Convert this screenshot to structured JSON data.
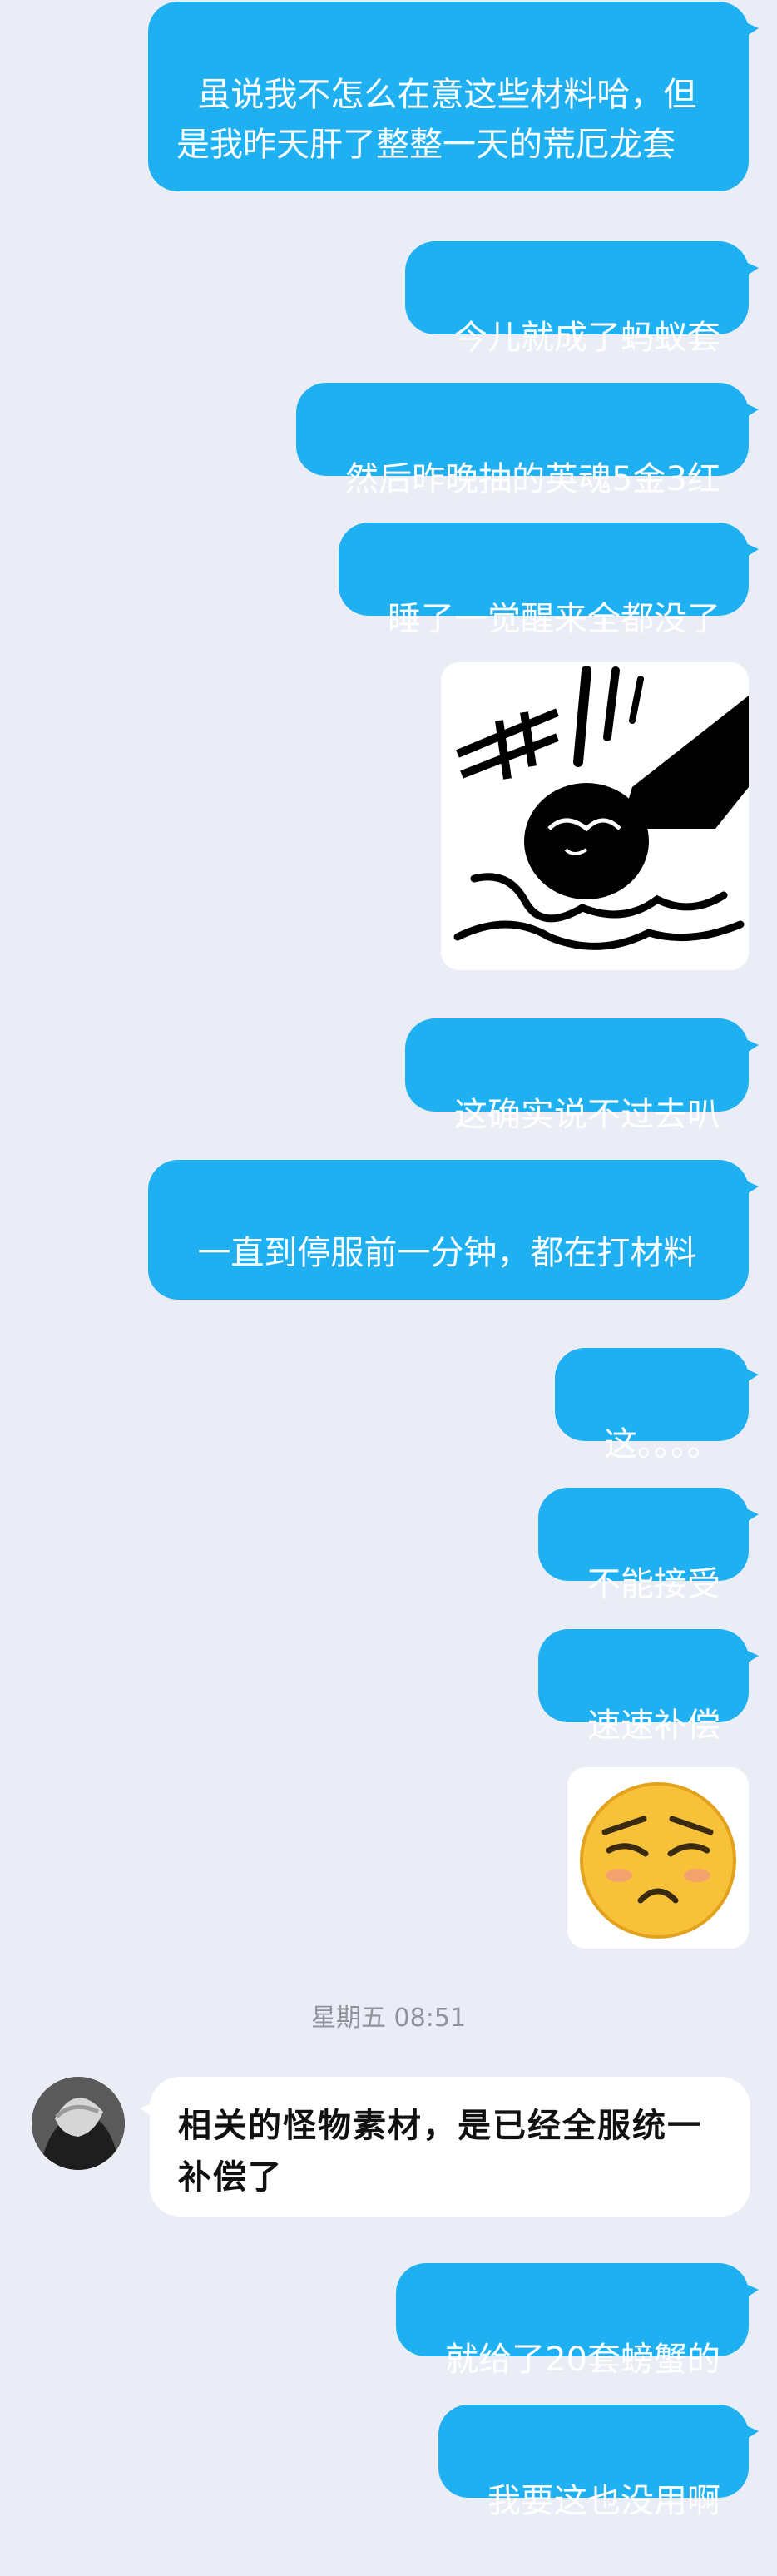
{
  "messages": [
    {
      "text": "虽说我不怎么在意这些材料哈，但是我昨天肝了整整一天的荒厄龙套"
    },
    {
      "text": "今儿就成了蚂蚁套"
    },
    {
      "text": "然后昨晚抽的英魂5金3红"
    },
    {
      "text": "睡了一觉醒来全都没了"
    },
    {
      "sticker": "fist-punch-meme"
    },
    {
      "text": "这确实说不过去叭"
    },
    {
      "text": "一直到停服前一分钟，都在打材料"
    },
    {
      "text": "这。。。。"
    },
    {
      "text": "不能接受"
    },
    {
      "text": "速速补偿"
    },
    {
      "sticker": "annoyed-emoji"
    }
  ],
  "timestamp": "星期五 08:51",
  "incoming": {
    "text": "相关的怪物素材，是已经全服统一补偿了"
  },
  "replies": [
    {
      "text": "就给了20套螃蟹的"
    },
    {
      "text": "我要这也没用啊"
    }
  ],
  "colors": {
    "outgoing_bubble": "#1fb0f2",
    "incoming_bubble": "#ffffff",
    "background": "#eaedf5"
  }
}
